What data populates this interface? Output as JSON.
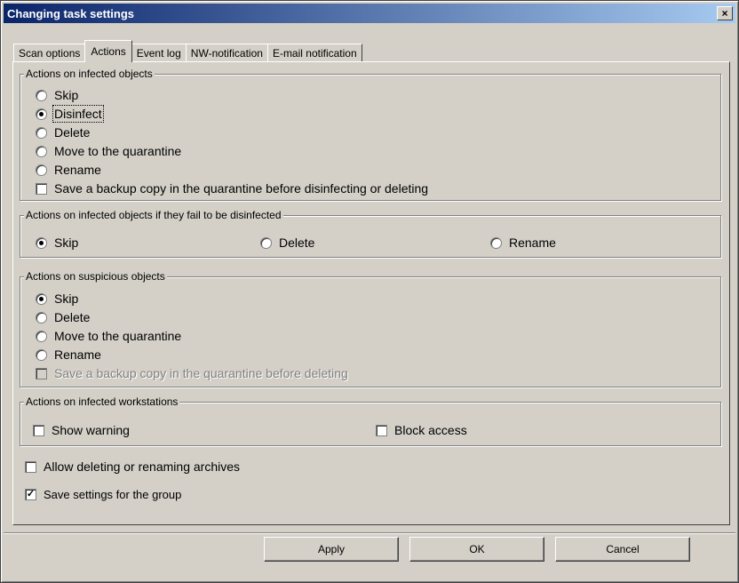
{
  "window": {
    "title": "Changing task settings",
    "close_label": "×"
  },
  "tabs": [
    {
      "label": "Scan options",
      "active": false
    },
    {
      "label": "Actions",
      "active": true
    },
    {
      "label": "Event log",
      "active": false
    },
    {
      "label": "NW-notification",
      "active": false
    },
    {
      "label": "E-mail notification",
      "active": false
    }
  ],
  "infected": {
    "title": "Actions on infected objects",
    "options": [
      "Skip",
      "Disinfect",
      "Delete",
      "Move to the quarantine",
      "Rename"
    ],
    "selected": "Disinfect",
    "backup_label": "Save a backup copy in the quarantine before disinfecting or deleting",
    "backup_checked": false
  },
  "fail": {
    "title": "Actions on infected objects if they fail to be disinfected",
    "options": [
      "Skip",
      "Delete",
      "Rename"
    ],
    "selected": "Skip"
  },
  "suspicious": {
    "title": "Actions on suspicious objects",
    "options": [
      "Skip",
      "Delete",
      "Move to the quarantine",
      "Rename"
    ],
    "selected": "Skip",
    "backup_label": "Save a backup copy in the quarantine before deleting",
    "backup_checked": false,
    "backup_disabled": true
  },
  "workstations": {
    "title": "Actions on infected workstations",
    "show_warning_label": "Show warning",
    "show_warning_checked": false,
    "block_access_label": "Block access",
    "block_access_checked": false
  },
  "archives": {
    "label": "Allow deleting or renaming archives",
    "checked": false
  },
  "group_save": {
    "label": "Save settings for the group",
    "checked": true
  },
  "buttons": {
    "apply": "Apply",
    "ok": "OK",
    "cancel": "Cancel"
  }
}
